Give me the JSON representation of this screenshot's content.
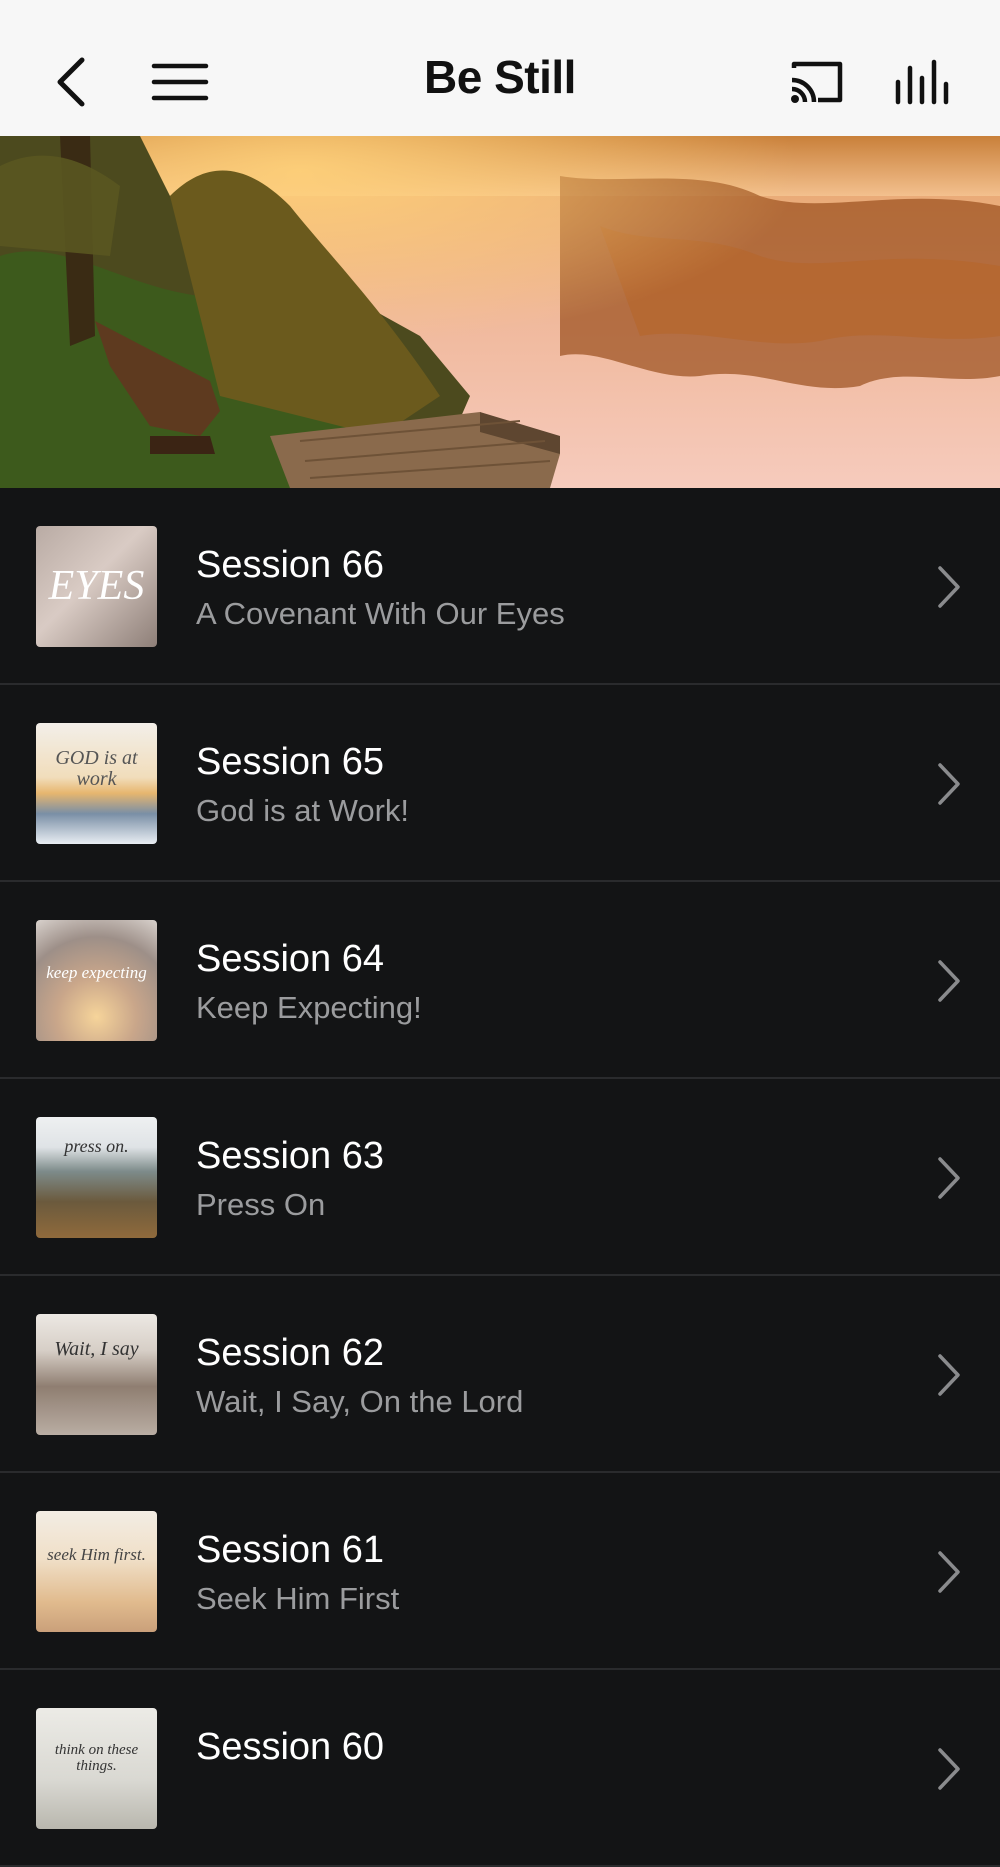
{
  "header": {
    "title": "Be Still",
    "icons": [
      "back-icon",
      "hamburger-menu-icon",
      "cast-icon",
      "equalizer-icon"
    ]
  },
  "sessions": [
    {
      "title": "Session 66",
      "subtitle": "A Covenant With Our Eyes",
      "thumb_text": "EYES"
    },
    {
      "title": "Session 65",
      "subtitle": "God is at Work!",
      "thumb_text": "GOD is at work"
    },
    {
      "title": "Session 64",
      "subtitle": "Keep Expecting!",
      "thumb_text": "keep expecting"
    },
    {
      "title": "Session 63",
      "subtitle": "Press On",
      "thumb_text": "press on."
    },
    {
      "title": "Session 62",
      "subtitle": "Wait, I Say, On the Lord",
      "thumb_text": "Wait, I say"
    },
    {
      "title": "Session 61",
      "subtitle": "Seek Him First",
      "thumb_text": "seek Him first."
    },
    {
      "title": "Session 60",
      "subtitle": "",
      "thumb_text": "think on these things."
    }
  ],
  "colors": {
    "background": "#131415",
    "header_bg": "#f7f7f7",
    "title_text": "#ffffff",
    "subtitle_text": "#9b9c9e",
    "divider": "#2a2b2d"
  }
}
